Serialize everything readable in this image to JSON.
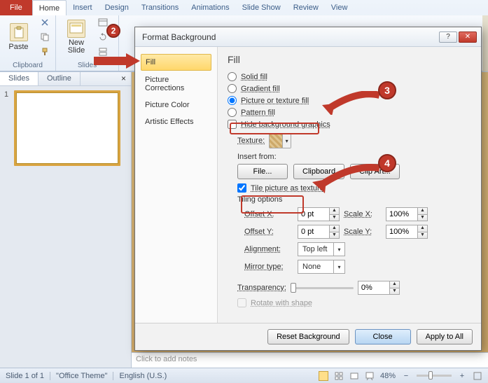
{
  "ribbon": {
    "file": "File",
    "tabs": [
      "Home",
      "Insert",
      "Design",
      "Transitions",
      "Animations",
      "Slide Show",
      "Review",
      "View"
    ],
    "active_tab": "Home",
    "paste": "Paste",
    "new_slide": "New\nSlide",
    "clipboard_group": "Clipboard",
    "slides_group": "Slides"
  },
  "pane": {
    "slides": "Slides",
    "outline": "Outline",
    "slide_number": "1"
  },
  "notes_placeholder": "Click to add notes",
  "status": {
    "slide": "Slide 1 of 1",
    "theme": "\"Office Theme\"",
    "lang": "English (U.S.)",
    "zoom": "48%"
  },
  "dialog": {
    "title": "Format Background",
    "nav": [
      "Fill",
      "Picture Corrections",
      "Picture Color",
      "Artistic Effects"
    ],
    "heading": "Fill",
    "radios": {
      "solid": "Solid fill",
      "gradient": "Gradient fill",
      "picture": "Picture or texture fill",
      "pattern": "Pattern fill"
    },
    "hide_bg": "Hide background graphics",
    "texture_label": "Texture:",
    "insert_from": "Insert from:",
    "btn_file": "File...",
    "btn_clipboard": "Clipboard",
    "btn_clipart": "Clip Art...",
    "tile": "Tile picture as texture",
    "tiling_options": "Tiling options",
    "offset_x": "Offset X:",
    "offset_y": "Offset Y:",
    "scale_x": "Scale X:",
    "scale_y": "Scale Y:",
    "offset_x_val": "0 pt",
    "offset_y_val": "0 pt",
    "scale_x_val": "100%",
    "scale_y_val": "100%",
    "alignment": "Alignment:",
    "alignment_val": "Top left",
    "mirror": "Mirror type:",
    "mirror_val": "None",
    "transparency": "Transparency:",
    "transparency_val": "0%",
    "rotate": "Rotate with shape",
    "reset": "Reset Background",
    "close": "Close",
    "apply_all": "Apply to All"
  },
  "callouts": {
    "n2": "2",
    "n3": "3",
    "n4": "4"
  }
}
